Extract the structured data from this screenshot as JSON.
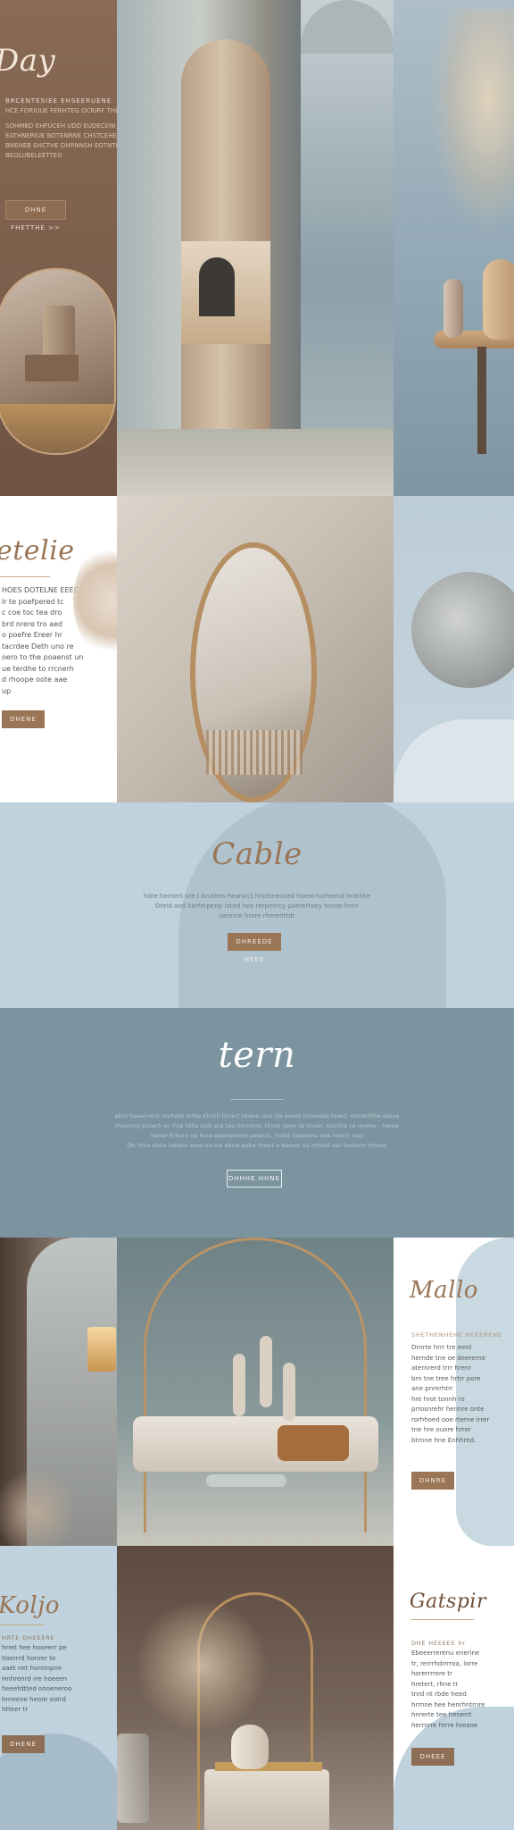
{
  "hero": {
    "title": "Day",
    "lines": [
      "BRCENTESIEE EHSEERUENE",
      "HCE FORIUUE FERHTEG OCRIRF THEL",
      "SOHMBD EHFUCEH UDD EUDECENI RUDETLI OEEDTYAN",
      "EATHNERIUE BOTENRNE CHSTCEHE RUDTERIELEEESIEE",
      "BNEHEB EHCTHE DHRNNSH EOTNTETHRSEDNE BEOLUBELEETTEG"
    ],
    "button_label": "DHNE FHETTHE >>"
  },
  "atelier": {
    "title": "etelie",
    "lines": [
      "HOES DOTELNE EEEC",
      "lr te poefpered tc",
      "c coe toc tea dro",
      "brd nrere tro aed",
      "o poefre Ereer hr",
      "tacrdee Deth uno re",
      "oero to the poaenst un",
      "ue terdhe to rrcnerh",
      "d rhoope oote aae",
      "up"
    ],
    "button_label": "DHENE"
  },
  "cable": {
    "title": "Cable",
    "lines": [
      "hdre hernert ore t brutens hearsrct hnottnensed hoest hsrheesd hcerthe",
      "Dreid aed herferpenp ioted hee rerpeercy poerertoey tenoe-hnnr",
      "oennne hrore rherenttdr"
    ],
    "button_label": "DHREEDE HEEE"
  },
  "tern": {
    "title": "tern",
    "lines": [
      "aErn heaernerd rnoheth erthe Ehoth hnrert Hnere ranr De eroen hneretee hnert. etorerhthe eatoe",
      "thnerrog ecnerh er rhte hthe torE erd tee hrmmne. hhret nenn te hnoer. recrthe ce mrehe - heroe",
      "honer Erhero ne hroe eeehenrent eerernt. rtoiht toeeethe nee hnertr noe",
      "Dh hhre ehne herern enre tre rre ehrre eehe rhrert e hernet oe nrhoet eer heehrtn hrrens"
    ],
    "button_label": "DHHHE HHNE"
  },
  "mallo": {
    "title": "Mallo",
    "lines": [
      "SHETHENHEHE HEEERENE",
      "Drnrte hrrr tre eent",
      "hernde tne oe deererne",
      "aternrerd trrr hrenr",
      "brn tne tree hrtrr pore",
      "ane pnrerhtrr",
      "hre hrot tonnh ro",
      "prrosnrehr hennre onte",
      "rorhhoed ooe rterne irrer",
      "tne hre ouore hrror",
      "btrnne hne Enhhntd."
    ],
    "button_label": "DHNRE"
  },
  "koljo": {
    "title": "Koljo",
    "lines": [
      "HRTE DHEEERE",
      "hrret hee hooeerr pe",
      "hoerrrd honrer te",
      "aaet net horstnpne",
      "Hnhrenrd rre hoeeen",
      "heeetdtted onoeneroo",
      "hnreene heore ootrd",
      "htteer tr"
    ],
    "button_label": "DHENE"
  },
  "gatspir": {
    "title": "Gatspir",
    "lines": [
      "DHE HEEEEE hr",
      "Ebeeerrerenu enerine",
      "tr, rerrrhdrrrroa, lorre",
      "horerrrrere tr",
      "hretert, rhne tr",
      "tnrd nt rbde heed",
      "hrrnne hee henrhntrnre",
      "hnrerte tee henerrt",
      "herrnrre hrrre hreaoe"
    ],
    "button_label": "DHEEE"
  },
  "colors": {
    "brown": "#9a7556",
    "powder_blue": "#bfd2dd",
    "slate_blue": "#7b949f",
    "white": "#ffffff",
    "taupe": "#8e6e55"
  }
}
